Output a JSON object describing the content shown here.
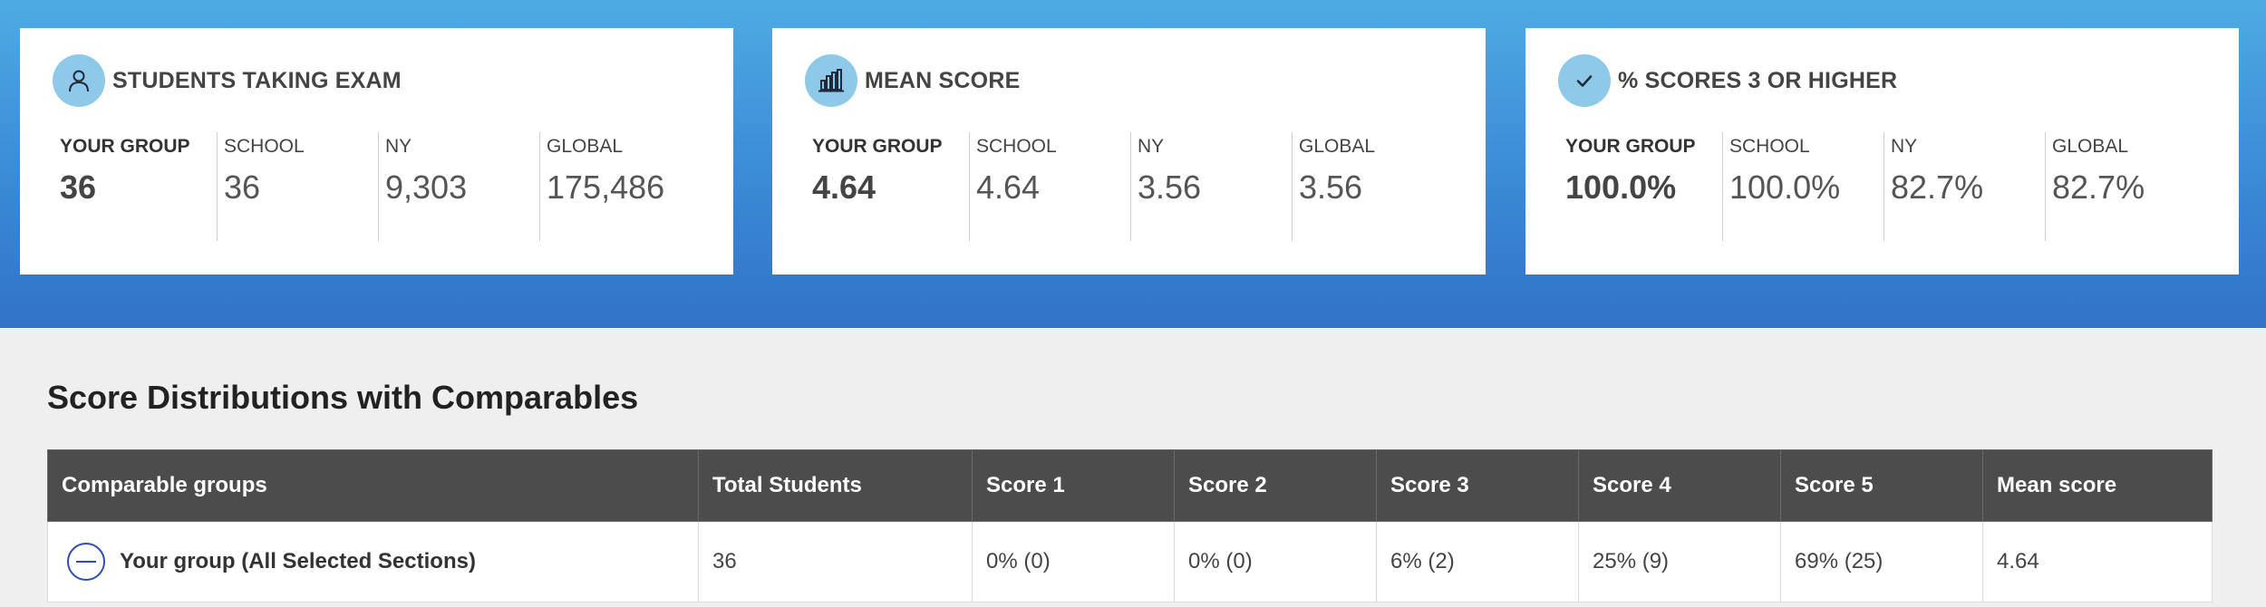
{
  "cards": [
    {
      "title": "STUDENTS TAKING EXAM",
      "icon": "person-icon",
      "stats": [
        {
          "label": "YOUR GROUP",
          "value": "36"
        },
        {
          "label": "SCHOOL",
          "value": "36"
        },
        {
          "label": "NY",
          "value": "9,303"
        },
        {
          "label": "GLOBAL",
          "value": "175,486"
        }
      ]
    },
    {
      "title": "MEAN SCORE",
      "icon": "bar-chart-icon",
      "stats": [
        {
          "label": "YOUR GROUP",
          "value": "4.64"
        },
        {
          "label": "SCHOOL",
          "value": "4.64"
        },
        {
          "label": "NY",
          "value": "3.56"
        },
        {
          "label": "GLOBAL",
          "value": "3.56"
        }
      ]
    },
    {
      "title": "% SCORES 3 OR HIGHER",
      "icon": "checkmark-icon",
      "stats": [
        {
          "label": "YOUR GROUP",
          "value": "100.0%"
        },
        {
          "label": "SCHOOL",
          "value": "100.0%"
        },
        {
          "label": "NY",
          "value": "82.7%"
        },
        {
          "label": "GLOBAL",
          "value": "82.7%"
        }
      ]
    }
  ],
  "section": {
    "title": "Score Distributions with Comparables"
  },
  "table": {
    "headers": [
      "Comparable groups",
      "Total Students",
      "Score 1",
      "Score 2",
      "Score 3",
      "Score 4",
      "Score 5",
      "Mean score"
    ],
    "rows": [
      {
        "group": "Your group (All Selected Sections)",
        "cells": [
          "36",
          "0% (0)",
          "0% (0)",
          "6% (2)",
          "25% (9)",
          "69% (25)",
          "4.64"
        ]
      }
    ]
  },
  "colors": {
    "banner_top": "#4fabe3",
    "banner_bottom": "#3273c6",
    "icon_bg": "#8ec9ea",
    "table_header": "#4c4c4c",
    "collapse_accent": "#2f4fb0"
  }
}
